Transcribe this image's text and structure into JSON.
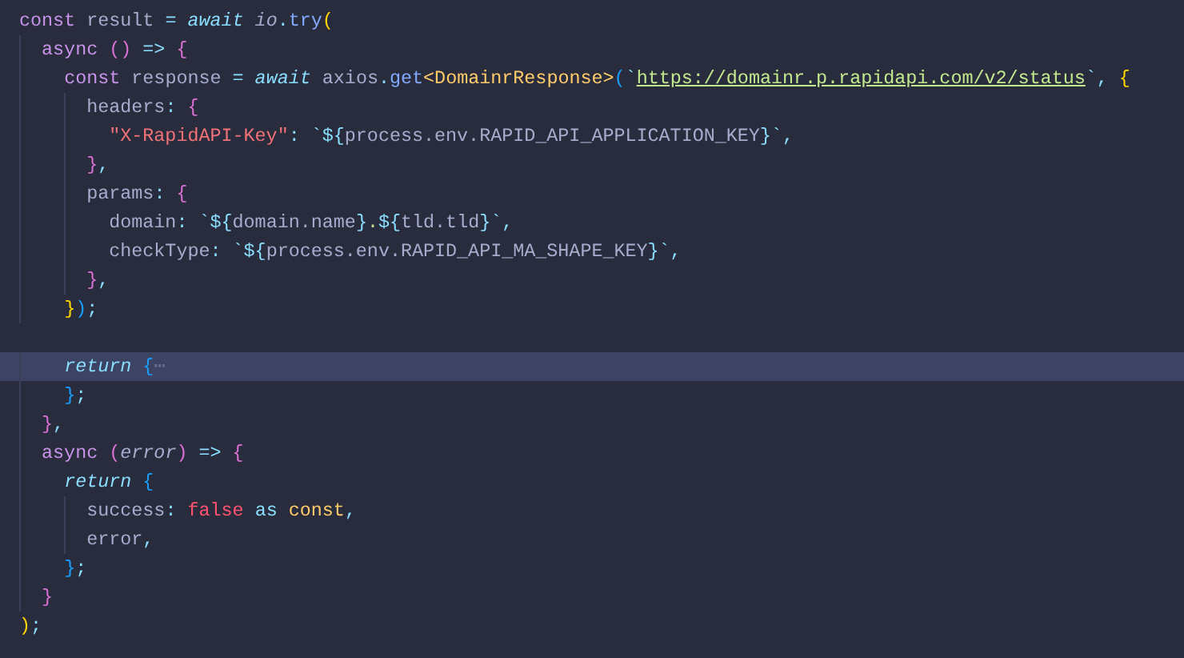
{
  "editor": {
    "lines": [
      {
        "current": false,
        "tokens": [
          {
            "kind": "keyword",
            "text": "const"
          },
          {
            "kind": "plain",
            "text": " result "
          },
          {
            "kind": "op",
            "text": "="
          },
          {
            "kind": "keyword-italic",
            "text": " await"
          },
          {
            "kind": "plain-italic",
            "text": " io"
          },
          {
            "kind": "op",
            "text": "."
          },
          {
            "kind": "function",
            "text": "try"
          },
          {
            "kind": "bracket-1",
            "text": "("
          }
        ]
      },
      {
        "current": false,
        "tokens": [
          {
            "kind": "keyword",
            "text": "  async"
          },
          {
            "kind": "bracket-2",
            "text": " ()"
          },
          {
            "kind": "op",
            "text": " =>"
          },
          {
            "kind": "bracket-2",
            "text": " {"
          }
        ]
      },
      {
        "current": false,
        "tokens": [
          {
            "kind": "keyword",
            "text": "    const"
          },
          {
            "kind": "plain",
            "text": " response "
          },
          {
            "kind": "op",
            "text": "="
          },
          {
            "kind": "keyword-italic",
            "text": " await"
          },
          {
            "kind": "plain",
            "text": " axios"
          },
          {
            "kind": "op",
            "text": "."
          },
          {
            "kind": "function",
            "text": "get"
          },
          {
            "kind": "type",
            "text": "<DomainrResponse>"
          },
          {
            "kind": "bracket-3",
            "text": "("
          },
          {
            "kind": "op",
            "text": "`"
          },
          {
            "kind": "link",
            "text": "https://domainr.p.rapidapi.com/v2/status"
          },
          {
            "kind": "op",
            "text": "`,"
          },
          {
            "kind": "bracket-1",
            "text": " {"
          }
        ]
      },
      {
        "current": false,
        "tokens": [
          {
            "kind": "plain",
            "text": "      headers"
          },
          {
            "kind": "op",
            "text": ":"
          },
          {
            "kind": "bracket-2",
            "text": " {"
          }
        ]
      },
      {
        "current": false,
        "tokens": [
          {
            "kind": "key",
            "text": "        \"X-RapidAPI-Key\""
          },
          {
            "kind": "op",
            "text": ": `${"
          },
          {
            "kind": "plain",
            "text": "process.env.RAPID_API_APPLICATION_KEY"
          },
          {
            "kind": "op",
            "text": "}`,"
          }
        ]
      },
      {
        "current": false,
        "tokens": [
          {
            "kind": "bracket-2",
            "text": "      }"
          },
          {
            "kind": "op",
            "text": ","
          }
        ]
      },
      {
        "current": false,
        "tokens": [
          {
            "kind": "plain",
            "text": "      params"
          },
          {
            "kind": "op",
            "text": ":"
          },
          {
            "kind": "bracket-2",
            "text": " {"
          }
        ]
      },
      {
        "current": false,
        "tokens": [
          {
            "kind": "plain",
            "text": "        domain"
          },
          {
            "kind": "op",
            "text": ": `${"
          },
          {
            "kind": "plain",
            "text": "domain.name"
          },
          {
            "kind": "op",
            "text": "}"
          },
          {
            "kind": "string",
            "text": "."
          },
          {
            "kind": "op",
            "text": "${"
          },
          {
            "kind": "plain",
            "text": "tld.tld"
          },
          {
            "kind": "op",
            "text": "}`,"
          }
        ]
      },
      {
        "current": false,
        "tokens": [
          {
            "kind": "plain",
            "text": "        checkType"
          },
          {
            "kind": "op",
            "text": ": `${"
          },
          {
            "kind": "plain",
            "text": "process.env.RAPID_API_MA_SHAPE_KEY"
          },
          {
            "kind": "op",
            "text": "}`,"
          }
        ]
      },
      {
        "current": false,
        "tokens": [
          {
            "kind": "bracket-2",
            "text": "      }"
          },
          {
            "kind": "op",
            "text": ","
          }
        ]
      },
      {
        "current": false,
        "tokens": [
          {
            "kind": "bracket-1",
            "text": "    }"
          },
          {
            "kind": "bracket-3",
            "text": ")"
          },
          {
            "kind": "op",
            "text": ";"
          }
        ]
      },
      {
        "current": false
      },
      {
        "current": true,
        "tokens": [
          {
            "kind": "keyword-italic",
            "text": "    return"
          },
          {
            "kind": "bracket-3",
            "text": " {"
          },
          {
            "kind": "fold",
            "text": "⋯"
          }
        ]
      },
      {
        "current": false,
        "tokens": [
          {
            "kind": "bracket-3",
            "text": "    }"
          },
          {
            "kind": "op",
            "text": ";"
          }
        ]
      },
      {
        "current": false,
        "tokens": [
          {
            "kind": "bracket-2",
            "text": "  }"
          },
          {
            "kind": "op",
            "text": ","
          }
        ]
      },
      {
        "current": false,
        "tokens": [
          {
            "kind": "keyword",
            "text": "  async"
          },
          {
            "kind": "bracket-2",
            "text": " ("
          },
          {
            "kind": "plain-italic",
            "text": "error"
          },
          {
            "kind": "bracket-2",
            "text": ")"
          },
          {
            "kind": "op",
            "text": " =>"
          },
          {
            "kind": "bracket-2",
            "text": " {"
          }
        ]
      },
      {
        "current": false,
        "tokens": [
          {
            "kind": "keyword-italic",
            "text": "    return"
          },
          {
            "kind": "bracket-3",
            "text": " {"
          }
        ]
      },
      {
        "current": false,
        "tokens": [
          {
            "kind": "plain",
            "text": "      success"
          },
          {
            "kind": "op",
            "text": ":"
          },
          {
            "kind": "boolean",
            "text": " false"
          },
          {
            "kind": "op",
            "text": " as"
          },
          {
            "kind": "type",
            "text": " const"
          },
          {
            "kind": "op",
            "text": ","
          }
        ]
      },
      {
        "current": false,
        "tokens": [
          {
            "kind": "plain",
            "text": "      error"
          },
          {
            "kind": "op",
            "text": ","
          }
        ]
      },
      {
        "current": false,
        "tokens": [
          {
            "kind": "bracket-3",
            "text": "    }"
          },
          {
            "kind": "op",
            "text": ";"
          }
        ]
      },
      {
        "current": false,
        "tokens": [
          {
            "kind": "bracket-2",
            "text": "  }"
          }
        ]
      },
      {
        "current": false,
        "tokens": [
          {
            "kind": "bracket-1",
            "text": ")"
          },
          {
            "kind": "op",
            "text": ";"
          }
        ]
      }
    ]
  }
}
